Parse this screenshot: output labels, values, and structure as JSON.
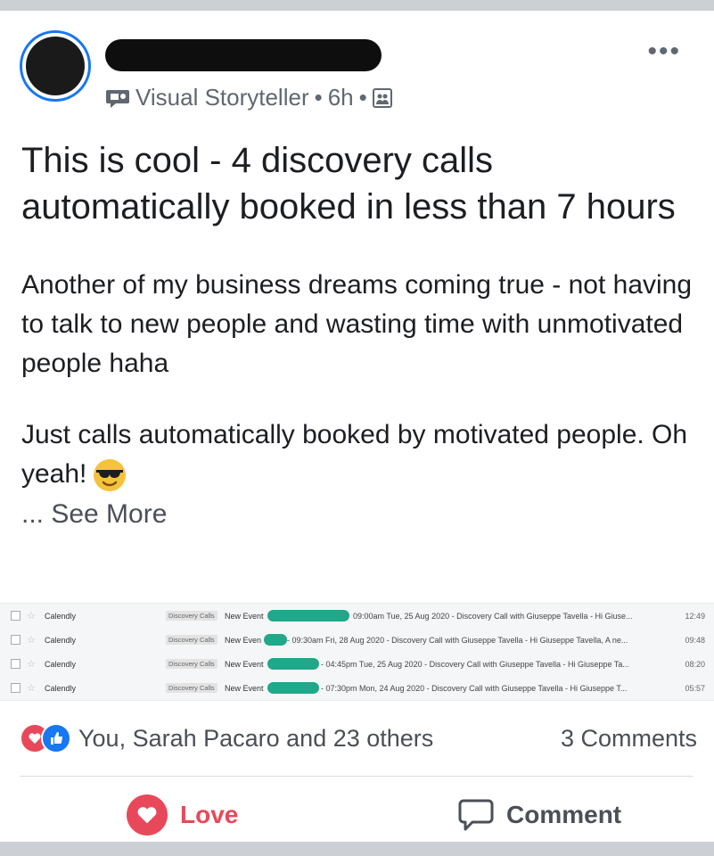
{
  "post": {
    "author_badge": "Visual Storyteller",
    "separator": "•",
    "time": "6h",
    "more_label": "•••",
    "headline": "This is cool - 4 discovery calls automatically booked in less than 7 hours",
    "paragraph2": "Another of my business dreams coming true - not having to talk to new people and wasting time with unmotivated people haha",
    "paragraph3": "Just calls automatically booked by motivated people. Oh yeah!",
    "see_more": "... See More"
  },
  "emails": [
    {
      "sender": "Calendly",
      "label": "Discovery Calls",
      "new_event": "New Event",
      "subject": "09:00am Tue, 25 Aug 2020 - Discovery Call with Giuseppe Tavella - Hi Giuse...",
      "time": "12:49"
    },
    {
      "sender": "Calendly",
      "label": "Discovery Calls",
      "new_event": "New Even",
      "subject": "- 09:30am Fri, 28 Aug 2020 - Discovery Call with Giuseppe Tavella - Hi Giuseppe Tavella, A ne...",
      "time": "09:48"
    },
    {
      "sender": "Calendly",
      "label": "Discovery Calls",
      "new_event": "New Event",
      "subject": "- 04:45pm Tue, 25 Aug 2020 - Discovery Call with Giuseppe Tavella - Hi Giuseppe Ta...",
      "time": "08:20"
    },
    {
      "sender": "Calendly",
      "label": "Discovery Calls",
      "new_event": "New Event",
      "subject": "- 07:30pm Mon, 24 Aug 2020 - Discovery Call with Giuseppe Tavella - Hi Giuseppe T...",
      "time": "05:57"
    }
  ],
  "reactions": {
    "summary": "You, Sarah Pacaro and 23 others",
    "comments": "3 Comments"
  },
  "actions": {
    "love": "Love",
    "comment": "Comment"
  },
  "colors": {
    "love": "#e8495a",
    "like": "#1877f2",
    "redaction": "#1fa88a"
  }
}
